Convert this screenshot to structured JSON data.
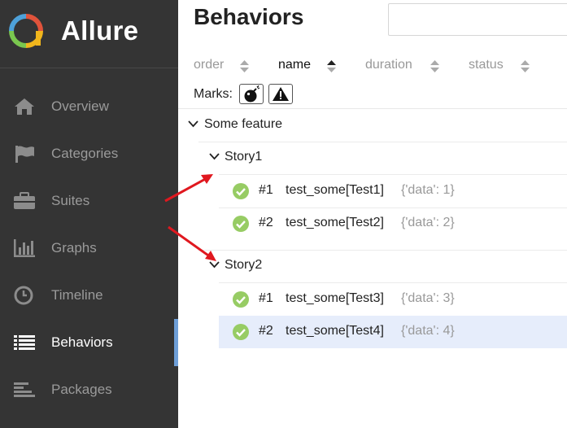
{
  "app": {
    "name": "Allure",
    "logo_colors": [
      "#7ac74f",
      "#f1b61c",
      "#e0533b",
      "#4ea1d9"
    ]
  },
  "sidebar": {
    "items": [
      {
        "label": "Overview",
        "icon": "home-icon"
      },
      {
        "label": "Categories",
        "icon": "flag-icon"
      },
      {
        "label": "Suites",
        "icon": "briefcase-icon"
      },
      {
        "label": "Graphs",
        "icon": "bar-chart-icon"
      },
      {
        "label": "Timeline",
        "icon": "clock-icon"
      },
      {
        "label": "Behaviors",
        "icon": "list-icon",
        "active": true
      },
      {
        "label": "Packages",
        "icon": "align-left-icon"
      }
    ],
    "active_color": "#6e9fd8"
  },
  "main": {
    "title": "Behaviors",
    "sort": {
      "order": "order",
      "name": "name",
      "duration": "duration",
      "status": "status",
      "active": "name"
    },
    "marks": {
      "label": "Marks:",
      "items": [
        "bomb-icon",
        "warning-icon"
      ]
    },
    "tree": {
      "feature": "Some feature",
      "stories": [
        {
          "name": "Story1",
          "tests": [
            {
              "num": "#1",
              "name": "test_some[Test1]",
              "param": "{'data': 1}",
              "status": "passed"
            },
            {
              "num": "#2",
              "name": "test_some[Test2]",
              "param": "{'data': 2}",
              "status": "passed"
            }
          ]
        },
        {
          "name": "Story2",
          "tests": [
            {
              "num": "#1",
              "name": "test_some[Test3]",
              "param": "{'data': 3}",
              "status": "passed"
            },
            {
              "num": "#2",
              "name": "test_some[Test4]",
              "param": "{'data': 4}",
              "status": "passed",
              "selected": true
            }
          ]
        }
      ]
    },
    "status_color": "#97cc64"
  },
  "annotation": {
    "arrow_color": "#e0181f"
  }
}
